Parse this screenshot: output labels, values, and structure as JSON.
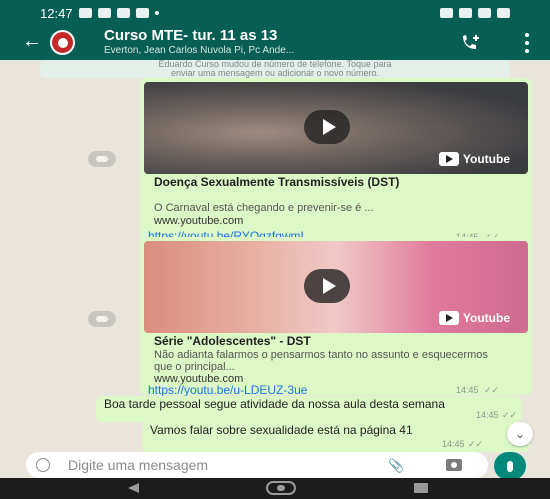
{
  "status_bar": {
    "time": "12:47"
  },
  "header": {
    "title": "Curso MTE- tur. 11 as 13",
    "subtitle": "Everton, Jean Carlos Nuvola Pi, Pc Ande..."
  },
  "system_note": {
    "line1": "Eduardo Curso mudou de número de telefone. Toque para",
    "line2": "enviar uma mensagem ou adicionar o novo número."
  },
  "messages": [
    {
      "youtube_label": "Youtube",
      "title": "Doença Sexualmente Transmissíveis (DST)",
      "description": "O Carnaval está chegando e prevenir-se é ...",
      "domain": "www.youtube.com",
      "url": "https://youtu.be/RYQgzfqwmI",
      "time": "14:45",
      "ticks": "✓✓"
    },
    {
      "youtube_label": "Youtube",
      "title": "Série \"Adolescentes\" - DST",
      "description": "Não adianta falarmos o pensarmos tanto no assunto e esquecermos que o principal...",
      "domain": "www.youtube.com",
      "url": "https://youtu.be/u-LDEUZ-3ue",
      "time": "14:45",
      "ticks": "✓✓"
    },
    {
      "text": "Boa tarde pessoal segue atividade da nossa aula desta semana",
      "time": "14:45",
      "ticks": "✓✓"
    },
    {
      "text": "Vamos falar sobre sexualidade está na página 41",
      "time": "14:45",
      "ticks": "✓✓"
    }
  ],
  "composer": {
    "placeholder": "Digite uma mensagem"
  },
  "colors": {
    "header": "#075e54",
    "outgoing_bubble": "#dcf8c6",
    "chat_background": "#e9e4dc",
    "mic_button": "#00897b",
    "link": "#1a73e8"
  },
  "icons": [
    "back-arrow-icon",
    "group-avatar-icon",
    "add-call-icon",
    "more-vert-icon",
    "play-icon",
    "youtube-icon",
    "forward-icon",
    "chevron-down-icon",
    "emoji-icon",
    "attach-icon",
    "camera-icon",
    "mic-icon",
    "nav-back-icon",
    "nav-home-icon",
    "nav-recents-icon"
  ]
}
